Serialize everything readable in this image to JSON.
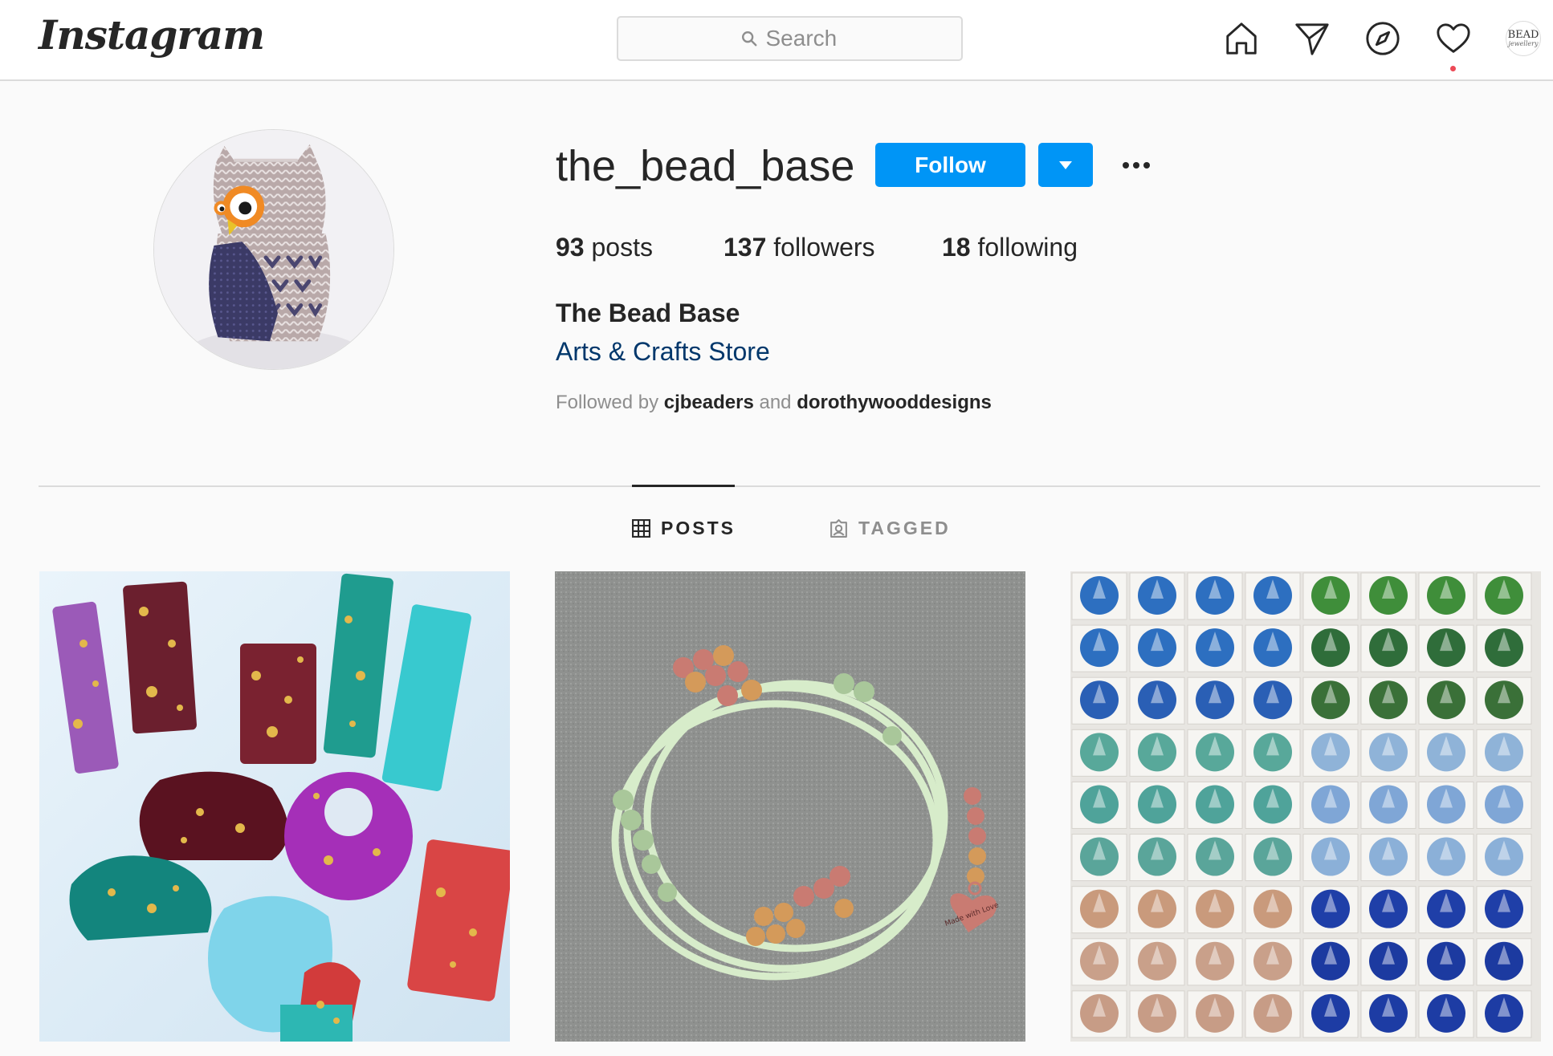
{
  "header": {
    "logo": "Instagram",
    "search_placeholder": "Search",
    "nav_avatar_line1": "BEAD",
    "nav_avatar_line2": "jewellery"
  },
  "profile": {
    "username": "the_bead_base",
    "follow_label": "Follow",
    "stats": {
      "posts_count": "93",
      "posts_label": "posts",
      "followers_count": "137",
      "followers_label": "followers",
      "following_count": "18",
      "following_label": "following"
    },
    "full_name": "The Bead Base",
    "category": "Arts & Crafts Store",
    "followed_by_prefix": "Followed by",
    "followed_by_user1": "cjbeaders",
    "followed_by_and": "and",
    "followed_by_user2": "dorothywooddesigns"
  },
  "tabs": {
    "posts_label": "POSTS",
    "tagged_label": "TAGGED"
  },
  "posts": [
    {
      "alt": "Resin pendants with gold leaf"
    },
    {
      "alt": "Memory wire bracelet with heart charm"
    },
    {
      "alt": "Rivoli crystals in trays"
    }
  ],
  "charm_text": "Made with Love",
  "colors": {
    "brand_blue": "#0095f6",
    "link_blue": "#00376b",
    "notification_red": "#ed4956"
  },
  "icons": [
    "search-icon",
    "home-icon",
    "direct-icon",
    "explore-icon",
    "heart-icon",
    "chevron-down-icon",
    "grid-icon",
    "tagged-icon"
  ]
}
